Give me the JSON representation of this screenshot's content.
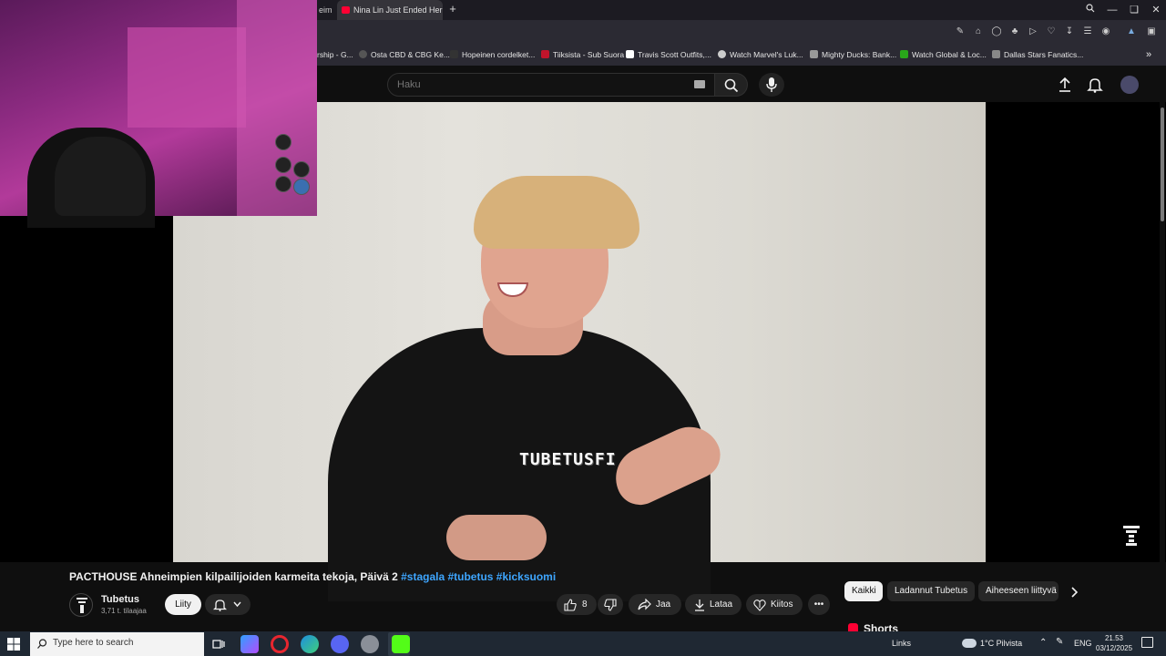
{
  "browser": {
    "prev_tab_label": "eim",
    "active_tab_label": "Nina Lin Just Ended Her C",
    "bookmarks": [
      {
        "label": "rship - G...",
        "color": "#888888"
      },
      {
        "label": "Osta CBD & CBG Ke...",
        "color": "#6b6b6b"
      },
      {
        "label": "Hopeinen cordelket...",
        "color": "#3a3a3a"
      },
      {
        "label": "Tiiksista - Sub Suora",
        "color": "#c0142b"
      },
      {
        "label": "Travis Scott Outfits,...",
        "color": "#ffffff"
      },
      {
        "label": "Watch Marvel's Luk...",
        "color": "#dddddd"
      },
      {
        "label": "Mighty Ducks: Bank...",
        "color": "#bbbbbb"
      },
      {
        "label": "Watch Global & Loc...",
        "color": "#29a61a"
      },
      {
        "label": "Dallas Stars Fanatics...",
        "color": "#aaaaaa"
      }
    ]
  },
  "youtube": {
    "search_placeholder": "Haku",
    "watermark_text": "TUBETUSFI",
    "video_title_main": "PACTHOUSE Ahneimpien kilpailijoiden karmeita tekoja, Päivä 2 ",
    "video_title_tags": "#stagala #tubetus #kicksuomi",
    "channel_name": "Tubetus",
    "subscribers": "3,71 t. tilaajaa",
    "join_label": "Liity",
    "like_count": "8",
    "share_label": "Jaa",
    "download_label": "Lataa",
    "thanks_label": "Kiitos",
    "chips": [
      "Kaikki",
      "Ladannut Tubetus",
      "Aiheeseen liittyvä"
    ],
    "shorts_label": "Shorts"
  },
  "taskbar": {
    "search_placeholder": "Type here to search",
    "links_label": "Links",
    "weather": "1°C  Pilvista",
    "language": "ENG",
    "time": "21.53",
    "date": "03/12/2025"
  },
  "colors": {
    "youtube_red": "#ff0033",
    "link_blue": "#3ea6ff",
    "background": "#0f0f0f"
  }
}
